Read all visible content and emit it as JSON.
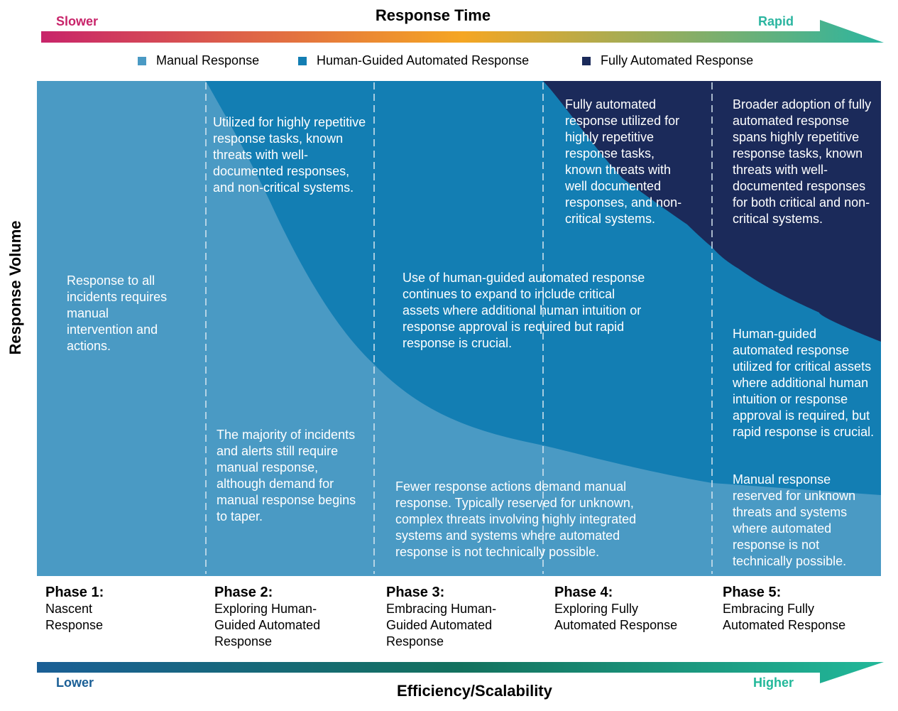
{
  "top_axis": {
    "title": "Response Time",
    "left_label": "Slower",
    "right_label": "Rapid",
    "left_color": "#c8246a",
    "right_color": "#2bb5a0"
  },
  "bottom_axis": {
    "title": "Efficiency/Scalability",
    "left_label": "Lower",
    "right_label": "Higher",
    "left_color": "#1a5f96",
    "right_color": "#22b89a"
  },
  "y_axis": {
    "title": "Response Volume"
  },
  "legend": [
    {
      "label": "Manual Response",
      "color": "#4a9ac4"
    },
    {
      "label": "Human-Guided Automated Response",
      "color": "#137eb3"
    },
    {
      "label": "Fully Automated Response",
      "color": "#1b2a5a"
    }
  ],
  "descriptions": {
    "p1_manual": "Response to all incidents requires manual intervention and actions.",
    "p2_guided": "Utilized for highly repetitive response tasks, known threats with well-documented responses, and non-critical systems.",
    "p2_manual": "The majority of incidents and alerts still require manual response, although demand for manual response begins to taper.",
    "p3_guided": "Use of human-guided automated response continues to expand to include critical assets where additional human intuition or response approval is required but rapid response is crucial.",
    "p3_manual": "Fewer response actions demand manual response. Typically reserved for unknown, complex threats involving highly integrated systems and systems where automated response is not technically possible.",
    "p4_full": "Fully automated response utilized for highly repetitive response tasks, known threats with well documented responses, and non-critical systems.",
    "p5_full": "Broader adoption of fully automated response spans highly repetitive response tasks, known threats with well-documented responses for both critical and non-critical systems.",
    "p5_guided": "Human-guided automated response utilized for critical assets where additional human intuition or response approval is required, but rapid response is crucial.",
    "p5_manual": "Manual response reserved for unknown threats and systems where automated response is not technically possible."
  },
  "phases": [
    {
      "title": "Phase 1:",
      "name": "Nascent Response"
    },
    {
      "title": "Phase 2:",
      "name": "Exploring Human-Guided Automated Response"
    },
    {
      "title": "Phase 3:",
      "name": "Embracing Human-Guided Automated Response"
    },
    {
      "title": "Phase 4:",
      "name": "Exploring Fully Automated Response"
    },
    {
      "title": "Phase 5:",
      "name": "Embracing Fully Automated Response"
    }
  ]
}
